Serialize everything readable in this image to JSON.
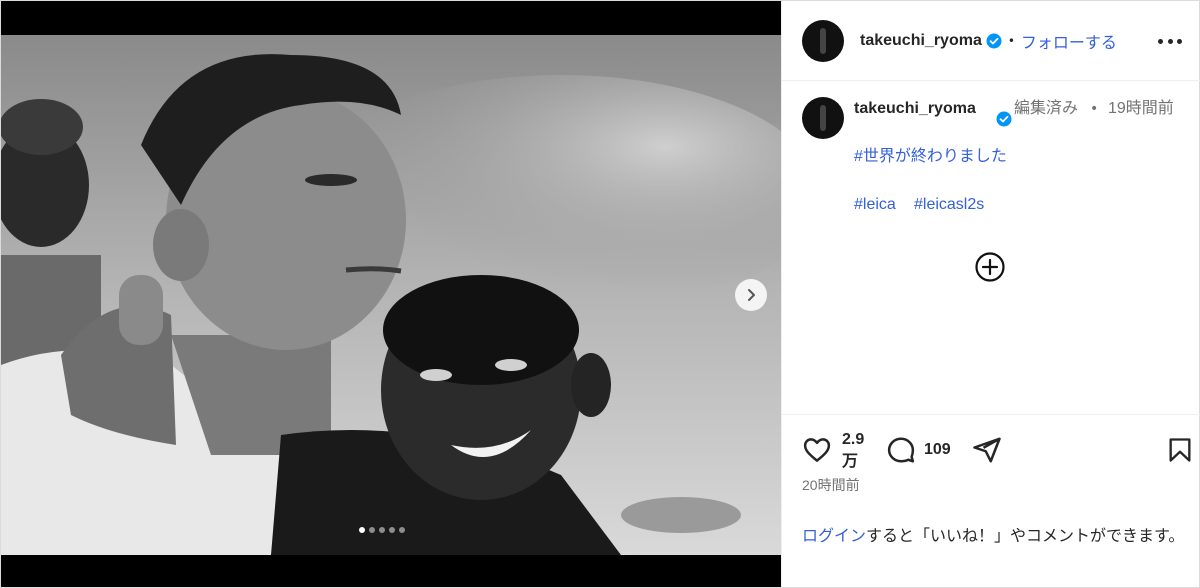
{
  "post": {
    "username": "takeuchi_ryoma",
    "follow_label": "フォローする",
    "separator": "•"
  },
  "caption": {
    "username": "takeuchi_ryoma",
    "edited": "編集済み",
    "separator": "•",
    "time": "19時間前",
    "hashtag_main": "#世界が終わりました",
    "hashtag_1": "#leica",
    "hashtag_2": "#leicasl2s"
  },
  "actions": {
    "likes": "2.9万",
    "comments": "109",
    "posted_time": "20時間前"
  },
  "login": {
    "link": "ログイン",
    "text": "すると「いいね！」やコメントができます。"
  },
  "carousel": {
    "total": 5,
    "current": 1
  },
  "icons": {
    "like": "heart-icon",
    "comment": "comment-icon",
    "share": "share-icon",
    "save": "bookmark-icon",
    "add_comment": "plus-circle-icon",
    "next": "chevron-right-icon",
    "more": "more-icon",
    "verified": "verified-badge-icon"
  },
  "colors": {
    "link": "#3460d9",
    "verified": "#0095f6",
    "muted": "#737373"
  }
}
